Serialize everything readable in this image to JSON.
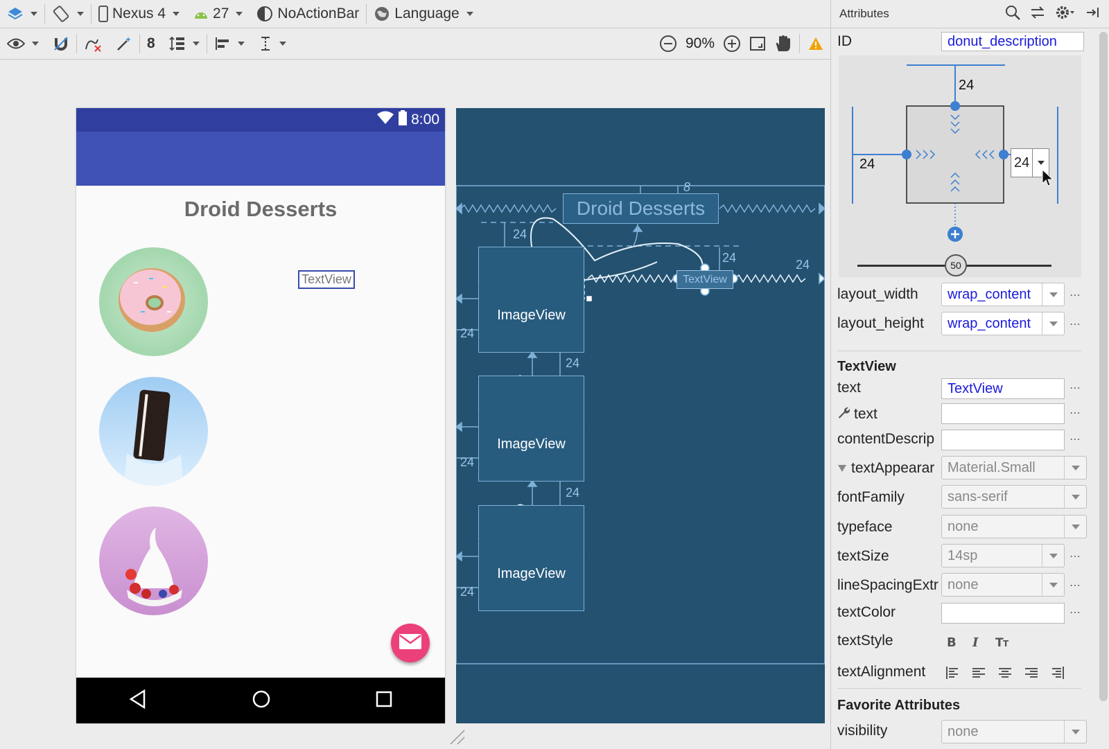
{
  "toolbar_top": {
    "device": "Nexus 4",
    "api_level": "27",
    "theme": "NoActionBar",
    "language": "Language"
  },
  "toolbar_second": {
    "margin_default": "8",
    "zoom": "90%"
  },
  "phone": {
    "clock": "8:00",
    "title": "Droid Desserts",
    "textview_label": "TextView",
    "colors": {
      "status_bar": "#303f9f",
      "app_bar": "#3f51b5",
      "fab": "#ec407a"
    }
  },
  "blueprint": {
    "title": "Droid Desserts",
    "textview_label": "TextView",
    "image_views": [
      "ImageView",
      "ImageView",
      "ImageView"
    ],
    "margins": [
      "8",
      "24",
      "24",
      "24",
      "24",
      "24",
      "24",
      "24",
      "24",
      "24"
    ]
  },
  "attributes": {
    "panel_title": "Attributes",
    "id_label": "ID",
    "id_value": "donut_description",
    "constraint": {
      "top": "24",
      "left": "24",
      "right": "24",
      "bias": "50"
    },
    "layout_width": {
      "label": "layout_width",
      "value": "wrap_content"
    },
    "layout_height": {
      "label": "layout_height",
      "value": "wrap_content"
    },
    "section_textview": "TextView",
    "text": {
      "label": "text",
      "value": "TextView"
    },
    "tools_text": {
      "label": "text",
      "value": ""
    },
    "content_description": {
      "label": "contentDescrip",
      "value": ""
    },
    "text_appearance": {
      "label": "textAppearar",
      "value": "Material.Small"
    },
    "font_family": {
      "label": "fontFamily",
      "value": "sans-serif"
    },
    "typeface": {
      "label": "typeface",
      "value": "none"
    },
    "text_size": {
      "label": "textSize",
      "value": "14sp"
    },
    "line_spacing": {
      "label": "lineSpacingExtr",
      "value": "none"
    },
    "text_color": {
      "label": "textColor",
      "value": ""
    },
    "text_style": {
      "label": "textStyle"
    },
    "text_alignment": {
      "label": "textAlignment"
    },
    "section_favorites": "Favorite Attributes",
    "visibility": {
      "label": "visibility",
      "value": "none"
    }
  },
  "icons": [
    "layers-icon",
    "rotate-icon",
    "phone-icon",
    "android-icon",
    "theme-icon",
    "globe-icon",
    "eye-icon",
    "magnet-icon",
    "clear-constraints-icon",
    "magic-wand-icon",
    "guidelines-icon",
    "align-icon",
    "pack-icon",
    "zoom-out-icon",
    "zoom-in-icon",
    "zoom-fit-icon",
    "pan-icon",
    "warning-icon",
    "search-icon",
    "swap-icon",
    "gear-icon",
    "pin-icon"
  ]
}
